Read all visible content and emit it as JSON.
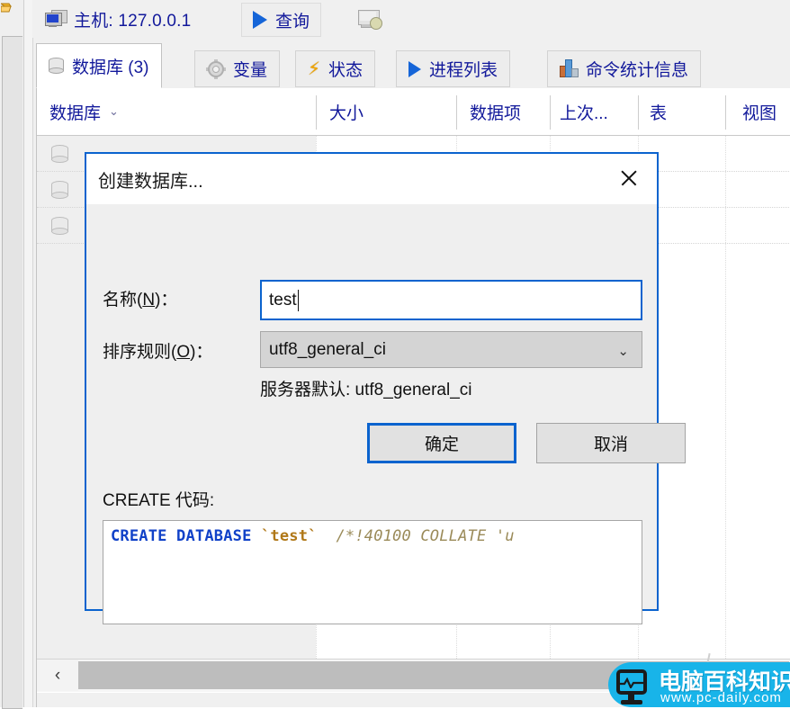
{
  "window": {
    "toolbar": {
      "host_label": "主机: 127.0.0.1",
      "host_icon": "monitor-icon",
      "query_label": "查询",
      "query_icon": "play-triangle-icon",
      "new_query_icon": "new-query-icon"
    },
    "tabs": [
      {
        "label": "数据库 (3)",
        "icon": "database-icon",
        "active": true
      },
      {
        "label": "变量",
        "icon": "gear-icon",
        "active": false
      },
      {
        "label": "状态",
        "icon": "lightning-bolt-icon",
        "active": false
      },
      {
        "label": "进程列表",
        "icon": "play-triangle-icon",
        "active": false
      },
      {
        "label": "命令统计信息",
        "icon": "bar-chart-icon",
        "active": false
      }
    ],
    "grid": {
      "columns": [
        {
          "label": "数据库",
          "sort_indicator": "⌄"
        },
        {
          "label": "大小"
        },
        {
          "label": "数据项"
        },
        {
          "label": "上次..."
        },
        {
          "label": "表"
        },
        {
          "label": "视图"
        }
      ],
      "rows": [
        {
          "icon": "database-icon"
        },
        {
          "icon": "database-icon"
        },
        {
          "icon": "database-icon"
        }
      ]
    },
    "scrollbar": {
      "left_arrow": "‹"
    }
  },
  "dialog": {
    "title": "创建数据库...",
    "close_icon": "close-icon",
    "name_label_prefix": "名称(",
    "name_label_key": "N",
    "name_label_suffix": ")：",
    "name_value": "test",
    "collation_label_prefix": "排序规则(",
    "collation_label_key": "O",
    "collation_label_suffix": ")：",
    "collation_value": "utf8_general_ci",
    "collation_chevron": "⌄",
    "server_default": "服务器默认: utf8_general_ci",
    "ok_button": "确定",
    "cancel_button": "取消",
    "create_code_label": "CREATE 代码:",
    "create_code": {
      "keyword": "CREATE DATABASE",
      "identifier": "`test`",
      "comment": "/*!40100 COLLATE 'u"
    }
  },
  "watermark": {
    "brand_cn": "电脑百科知识",
    "url": "www.pc-daily.com",
    "icon": "monitor-heartbeat-icon",
    "color": "#18b4e9"
  },
  "colors": {
    "accent_blue": "#0a63ce",
    "link_blue": "#12199b",
    "sql_keyword": "#1041c8",
    "sql_identifier": "#b07818",
    "sql_comment": "#9a8a58"
  }
}
